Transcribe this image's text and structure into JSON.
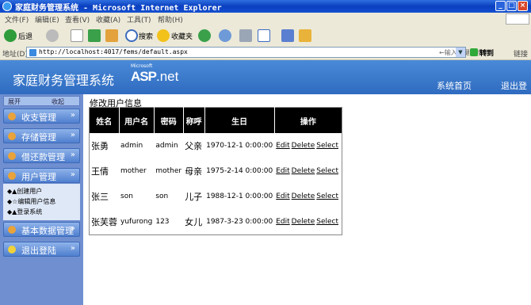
{
  "window": {
    "title": "家庭财务管理系统 - Microsoft Internet Explorer",
    "minimize": "_",
    "maximize": "□",
    "close": "×"
  },
  "menu": [
    "文件(F)",
    "编辑(E)",
    "查看(V)",
    "收藏(A)",
    "工具(T)",
    "帮助(H)"
  ],
  "toolbar": {
    "back": "后退",
    "search": "搜索",
    "favorites": "收藏夹"
  },
  "address": {
    "label": "地址(D)",
    "url": "http://localhost:4017/fems/default.aspx",
    "hint": "←输入关键词搜索",
    "go": "转到",
    "links": "链接"
  },
  "banner": {
    "title": "家庭财务管理系统",
    "logo_ms": "Microsoft",
    "logo_asp": "ASP",
    "logo_net": ".net",
    "home": "系统首页",
    "logout": "退出登"
  },
  "sidebar": {
    "expand": "展开",
    "collapse": "收起",
    "menus": [
      "收支管理",
      "存储管理",
      "借还款管理",
      "用户管理",
      "基本数据管理",
      "退出登陆"
    ],
    "sub_items": [
      "◆▲创建用户",
      "◆☆编辑用户信息",
      "◆▲登录系统"
    ]
  },
  "content": {
    "section_title": "修改用户信息",
    "columns": [
      "姓名",
      "用户名",
      "密码",
      "称呼",
      "生日",
      "操作"
    ],
    "rows": [
      {
        "name": "张勇",
        "username": "admin",
        "password": "admin",
        "title": "父亲",
        "birthday": "1970-12-1 0:00:00"
      },
      {
        "name": "王倩",
        "username": "mother",
        "password": "mother",
        "title": "母亲",
        "birthday": "1975-2-14 0:00:00"
      },
      {
        "name": "张三",
        "username": "son",
        "password": "son",
        "title": "儿子",
        "birthday": "1988-12-1 0:00:00"
      },
      {
        "name": "张芙蓉",
        "username": "yufurong",
        "password": "123",
        "title": "女儿",
        "birthday": "1987-3-23 0:00:00"
      }
    ],
    "actions": {
      "edit": "Edit",
      "delete": "Delete",
      "select": "Select"
    }
  }
}
